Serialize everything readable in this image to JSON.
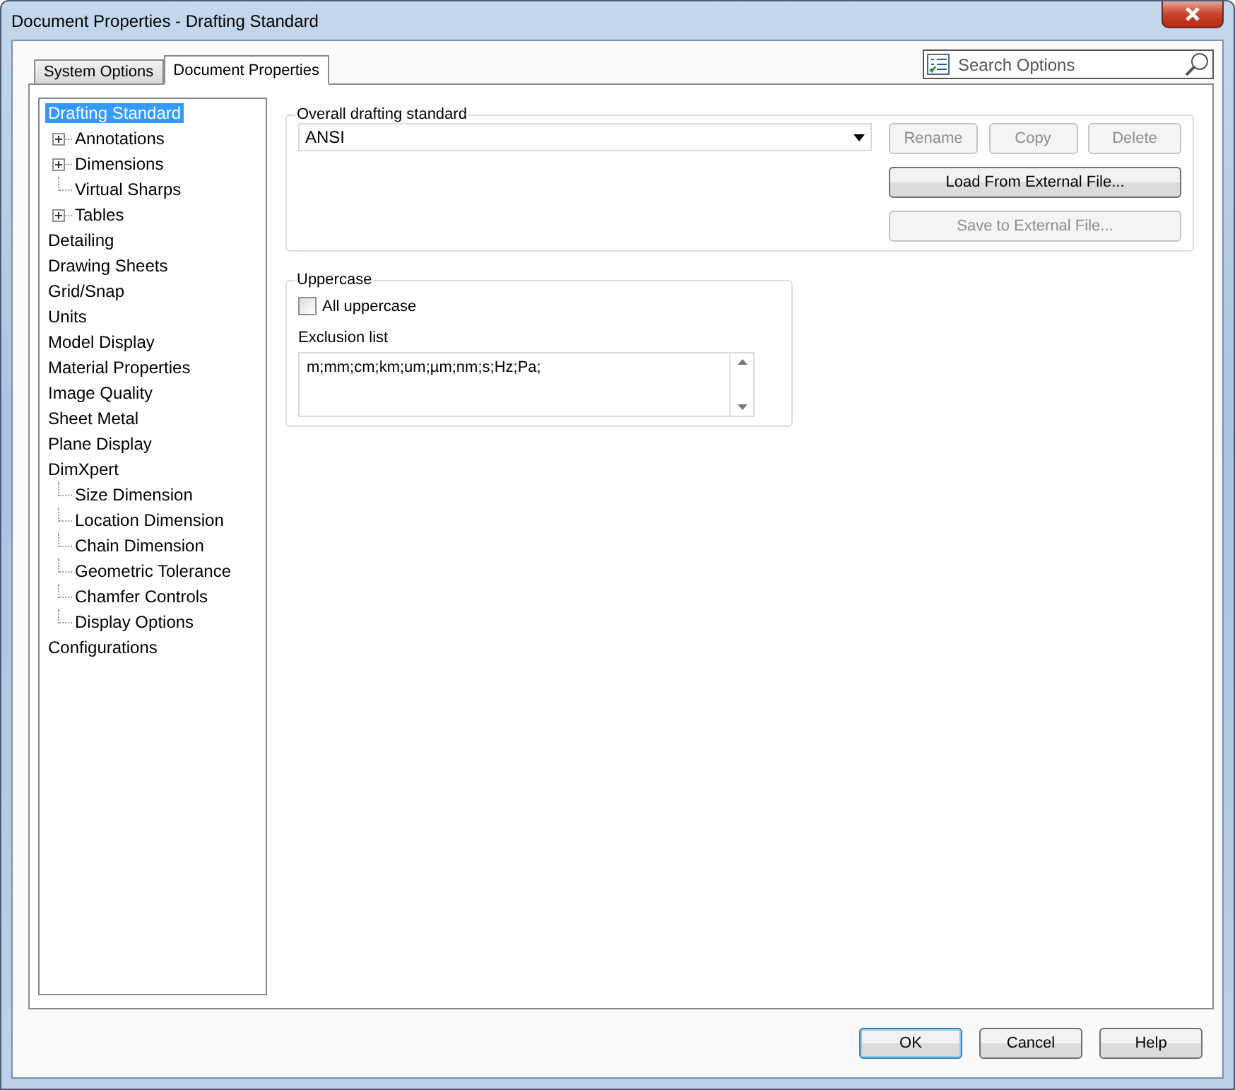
{
  "window": {
    "title": "Document Properties - Drafting Standard"
  },
  "tabs": [
    {
      "label": "System Options",
      "selected": false
    },
    {
      "label": "Document Properties",
      "selected": true
    }
  ],
  "search": {
    "placeholder": "Search Options"
  },
  "tree": [
    {
      "label": "Drafting Standard",
      "selected": true,
      "children": [
        {
          "label": "Annotations",
          "selected": false,
          "expanded": false
        },
        {
          "label": "Dimensions",
          "selected": false,
          "expanded": false
        },
        {
          "label": "Virtual Sharps",
          "selected": false
        },
        {
          "label": "Tables",
          "selected": false,
          "expanded": false
        }
      ]
    },
    {
      "label": "Detailing",
      "selected": false
    },
    {
      "label": "Drawing Sheets",
      "selected": false
    },
    {
      "label": "Grid/Snap",
      "selected": false
    },
    {
      "label": "Units",
      "selected": false
    },
    {
      "label": "Model Display",
      "selected": false
    },
    {
      "label": "Material Properties",
      "selected": false
    },
    {
      "label": "Image Quality",
      "selected": false
    },
    {
      "label": "Sheet Metal",
      "selected": false
    },
    {
      "label": "Plane Display",
      "selected": false
    },
    {
      "label": "DimXpert",
      "selected": false,
      "children": [
        {
          "label": "Size Dimension",
          "selected": false
        },
        {
          "label": "Location Dimension",
          "selected": false
        },
        {
          "label": "Chain Dimension",
          "selected": false
        },
        {
          "label": "Geometric Tolerance",
          "selected": false
        },
        {
          "label": "Chamfer Controls",
          "selected": false
        },
        {
          "label": "Display Options",
          "selected": false
        }
      ]
    },
    {
      "label": "Configurations",
      "selected": false
    }
  ],
  "standard_group": {
    "title": "Overall drafting standard",
    "value": "ANSI",
    "buttons": [
      {
        "label": "Rename",
        "disabled": true
      },
      {
        "label": "Copy",
        "disabled": true
      },
      {
        "label": "Delete",
        "disabled": true
      },
      {
        "label": "Load From External File...",
        "disabled": false
      },
      {
        "label": "Save to External File...",
        "disabled": true
      }
    ]
  },
  "uppercase_group": {
    "title": "Uppercase",
    "checkbox": {
      "label": "All uppercase",
      "checked": false
    },
    "exclusion_label": "Exclusion list",
    "exclusion_value": "m;mm;cm;km;um;µm;nm;s;Hz;Pa;"
  },
  "footer_buttons": [
    {
      "label": "OK",
      "default": true
    },
    {
      "label": "Cancel",
      "default": false
    },
    {
      "label": "Help",
      "default": false
    }
  ]
}
